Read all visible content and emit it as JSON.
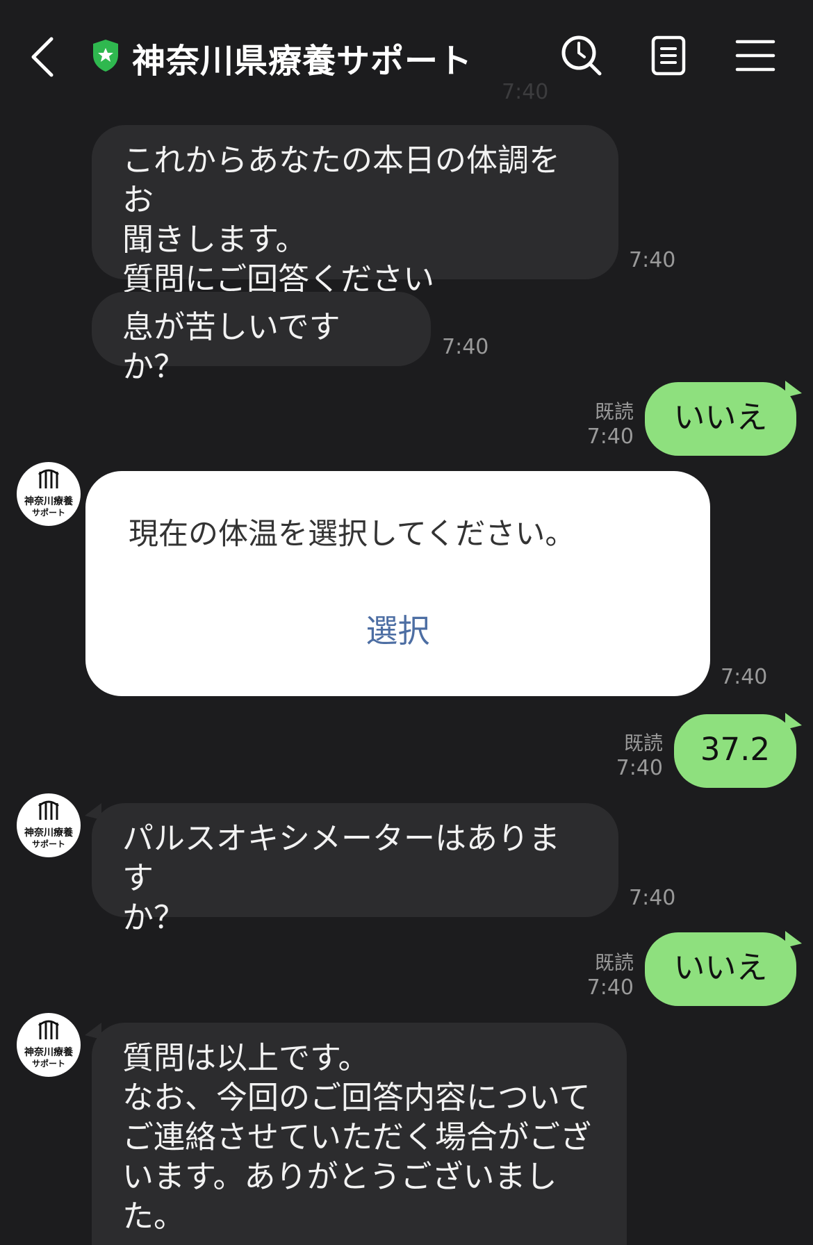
{
  "header": {
    "title": "神奈川県療養サポート",
    "ghost_time": "7:40"
  },
  "avatar": {
    "line1": "神奈川療養",
    "line2": "サポート"
  },
  "messages": [
    {
      "text": "これからあなたの本日の体調をお\n聞きします。\n質問にご回答ください",
      "time": "7:40"
    },
    {
      "text": "息が苦しいですか？",
      "time": "7:40"
    },
    {
      "text": "いいえ",
      "read": "既読",
      "time": "7:40"
    },
    {
      "text": "現在の体温を選択してください。",
      "button": "選択",
      "time": "7:40"
    },
    {
      "text": "37.2",
      "read": "既読",
      "time": "7:40"
    },
    {
      "text": "パルスオキシメーターはあります\nか？",
      "time": "7:40"
    },
    {
      "text": "いいえ",
      "read": "既読",
      "time": "7:40"
    },
    {
      "text": "質問は以上です。\nなお、今回のご回答内容について\nご連絡させていただく場合がござ\nいます。ありがとうございまし\nた。"
    }
  ],
  "colors": {
    "background": "#1c1c1e",
    "bot_bubble": "#2c2c2e",
    "user_bubble": "#8ee07e",
    "official_badge": "#2fb84f",
    "select_button": "#4d6ea3"
  },
  "icons": {
    "back": "chevron-left-icon",
    "badge": "shield-star-icon",
    "search": "search-clock-icon",
    "notes": "notes-icon",
    "menu": "hamburger-menu-icon"
  }
}
